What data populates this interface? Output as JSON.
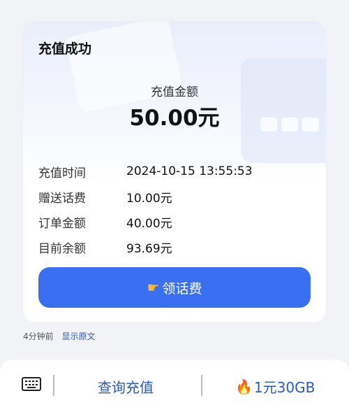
{
  "card": {
    "title": "充值成功",
    "amount_label": "充值金额",
    "amount_value": "50.00元",
    "rows": [
      {
        "label": "充值时间",
        "value": "2024-10-15 13:55:53"
      },
      {
        "label": "赠送话费",
        "value": "10.00元"
      },
      {
        "label": "订单金额",
        "value": "40.00元"
      },
      {
        "label": "目前余额",
        "value": "93.69元"
      }
    ],
    "button_label": "领话费",
    "button_icon": "pointing-hand-icon"
  },
  "meta": {
    "time": "4分钟前",
    "show_original": "显示原文"
  },
  "bottom_bar": {
    "keyboard_icon": "keyboard-icon",
    "query_label": "查询充值",
    "promo_label": "1元30GB",
    "promo_icon": "fire-icon"
  },
  "colors": {
    "accent": "#3a6ff2",
    "link": "#2b58c9",
    "background": "#f2f3f7"
  }
}
